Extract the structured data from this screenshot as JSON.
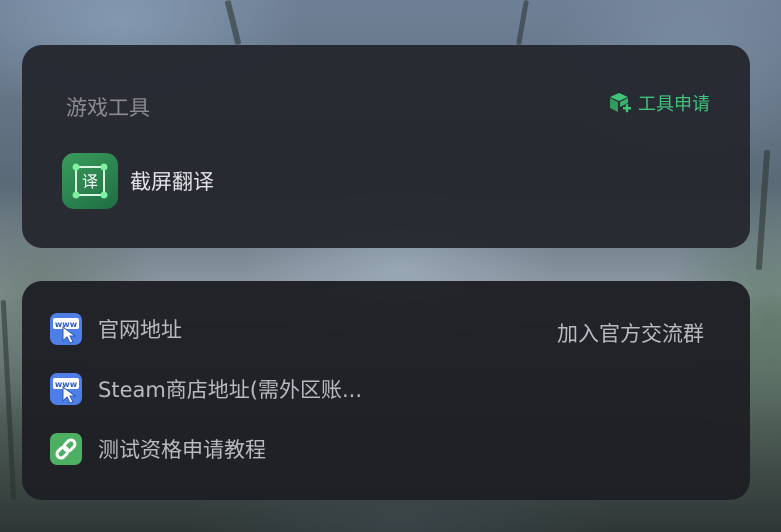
{
  "tools_card": {
    "title": "游戏工具",
    "apply_label": "工具申请",
    "items": [
      {
        "label": "截屏翻译",
        "icon_glyph": "译"
      }
    ]
  },
  "links_card": {
    "join_group_label": "加入官方交流群",
    "links": [
      {
        "label": "官网地址",
        "icon": "www-icon"
      },
      {
        "label": "Steam商店地址(需外区账...",
        "icon": "www-icon"
      },
      {
        "label": "测试资格申请教程",
        "icon": "link-icon"
      }
    ]
  },
  "colors": {
    "accent_green": "#3fc47a",
    "www_icon_blue": "#4d7fe6",
    "link_icon_green": "#4caf62"
  }
}
